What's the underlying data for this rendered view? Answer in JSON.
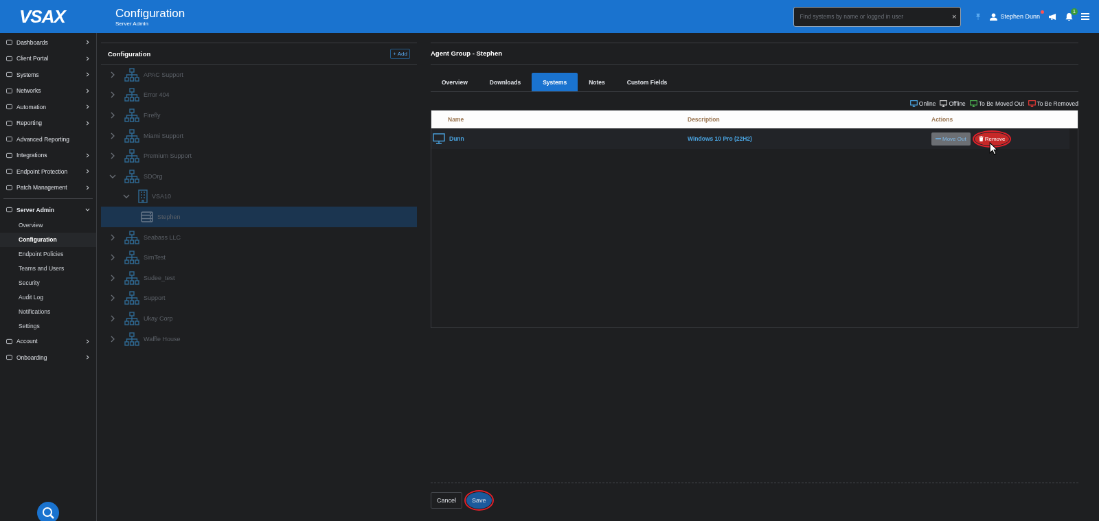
{
  "header": {
    "logo": "VSAX",
    "title": "Configuration",
    "subtitle": "Server Admin",
    "search": {
      "placeholder": "Find systems by name or logged in user",
      "clear": "×"
    },
    "user": "Stephen Dunn",
    "user_alert": true,
    "notifications": "1"
  },
  "sidebar": {
    "items": [
      {
        "label": "Dashboards",
        "has_children": true,
        "expanded": false
      },
      {
        "label": "Client Portal",
        "has_children": true,
        "expanded": false
      },
      {
        "label": "Systems",
        "has_children": true,
        "expanded": false
      },
      {
        "label": "Networks",
        "has_children": true,
        "expanded": false
      },
      {
        "label": "Automation",
        "has_children": true,
        "expanded": false
      },
      {
        "label": "Reporting",
        "has_children": true,
        "expanded": false
      },
      {
        "label": "Advanced Reporting",
        "has_children": false,
        "expanded": false
      },
      {
        "label": "Integrations",
        "has_children": true,
        "expanded": false
      },
      {
        "label": "Endpoint Protection",
        "has_children": true,
        "expanded": false
      },
      {
        "label": "Patch Management",
        "has_children": true,
        "expanded": false
      },
      {
        "label": "Server Admin",
        "has_children": true,
        "expanded": true,
        "children": [
          {
            "label": "Overview",
            "selected": false
          },
          {
            "label": "Configuration",
            "selected": true
          },
          {
            "label": "Endpoint Policies",
            "selected": false
          },
          {
            "label": "Teams and Users",
            "selected": false
          },
          {
            "label": "Security",
            "selected": false
          },
          {
            "label": "Audit Log",
            "selected": false
          },
          {
            "label": "Notifications",
            "selected": false
          },
          {
            "label": "Settings",
            "selected": false
          }
        ]
      },
      {
        "label": "Account",
        "has_children": true,
        "expanded": false
      },
      {
        "label": "Onboarding",
        "has_children": true,
        "expanded": false
      }
    ]
  },
  "tree_panel": {
    "title": "Configuration",
    "add_button": "+ Add",
    "nodes": [
      {
        "label": "APAC Support",
        "kind": "org",
        "expanded": false,
        "selected": false
      },
      {
        "label": "Error 404",
        "kind": "org",
        "expanded": false,
        "selected": false
      },
      {
        "label": "Firefly",
        "kind": "org",
        "expanded": false,
        "selected": false
      },
      {
        "label": "Miami Support",
        "kind": "org",
        "expanded": false,
        "selected": false
      },
      {
        "label": "Premium Support",
        "kind": "org",
        "expanded": false,
        "selected": false
      },
      {
        "label": "SDOrg",
        "kind": "org",
        "expanded": true,
        "selected": false,
        "children": [
          {
            "label": "VSA10",
            "kind": "site",
            "expanded": true,
            "selected": false,
            "children": [
              {
                "label": "Stephen",
                "kind": "group",
                "selected": true
              }
            ]
          }
        ]
      },
      {
        "label": "Seabass LLC",
        "kind": "org",
        "expanded": false,
        "selected": false
      },
      {
        "label": "SimTest",
        "kind": "org",
        "expanded": false,
        "selected": false
      },
      {
        "label": "Sudee_test",
        "kind": "org",
        "expanded": false,
        "selected": false
      },
      {
        "label": "Support",
        "kind": "org",
        "expanded": false,
        "selected": false
      },
      {
        "label": "Ukay Corp",
        "kind": "org",
        "expanded": false,
        "selected": false
      },
      {
        "label": "Waffle House",
        "kind": "org",
        "expanded": false,
        "selected": false
      }
    ]
  },
  "detail_panel": {
    "title": "Agent Group - Stephen",
    "tabs": [
      {
        "label": "Overview",
        "selected": false
      },
      {
        "label": "Downloads",
        "selected": false
      },
      {
        "label": "Systems",
        "selected": true
      },
      {
        "label": "Notes",
        "selected": false
      },
      {
        "label": "Custom Fields",
        "selected": false
      }
    ],
    "legend": [
      {
        "label": "Online",
        "color": "#4aa3df"
      },
      {
        "label": "Offline",
        "color": "#cccccc"
      },
      {
        "label": "To Be Moved Out",
        "color": "#4caf50"
      },
      {
        "label": "To Be Removed",
        "color": "#e53935"
      }
    ],
    "table": {
      "columns": [
        "Name",
        "Description",
        "Actions"
      ],
      "rows": [
        {
          "name": "Dunn",
          "description": "Windows 10 Pro (22H2)",
          "actions": [
            {
              "label": "Move Out",
              "kind": "move",
              "annotated": false
            },
            {
              "label": "Remove",
              "kind": "remove",
              "annotated": true
            }
          ]
        }
      ]
    },
    "footer_buttons": [
      {
        "label": "Cancel",
        "kind": "secondary",
        "annotated": false
      },
      {
        "label": "Save",
        "kind": "primary",
        "annotated": true
      }
    ]
  }
}
